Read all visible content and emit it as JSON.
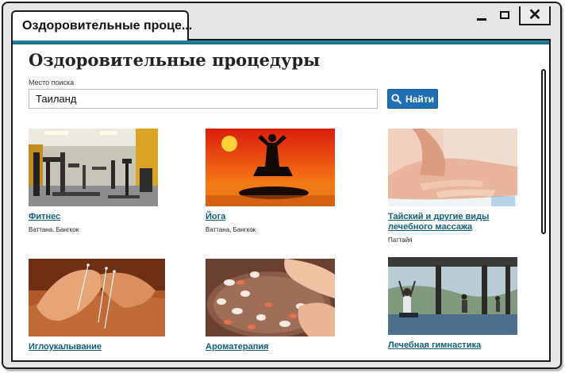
{
  "window": {
    "tab_title": "Оздоровительные проце...",
    "controls": {
      "minimize_icon": "minimize-icon",
      "maximize_icon": "maximize-icon",
      "close_label": "✕"
    }
  },
  "page": {
    "title": "Оздоровительные процедуры",
    "accent_color": "#14677f",
    "link_color": "#0f5f7a"
  },
  "search": {
    "label": "Место поиска",
    "value": "Таиланд",
    "button_label": "Найти",
    "button_icon": "search-icon",
    "button_color": "#1f6fb3"
  },
  "results": [
    {
      "title": "Фитнес",
      "location": "Ваттана, Бангкок",
      "image": "gym-equipment-photo"
    },
    {
      "title": "Йога",
      "location": "Ваттана, Бангкок",
      "image": "yoga-sunset-silhouette-photo"
    },
    {
      "title": "Тайский и другие виды лечебного массажа",
      "location": "Паттайя",
      "image": "back-massage-photo"
    },
    {
      "title": "Иглоукалывание",
      "location": "",
      "image": "acupuncture-photo"
    },
    {
      "title": "Ароматерапия",
      "location": "",
      "image": "flower-petals-bowl-photo"
    },
    {
      "title": "Лечебная гимнастика",
      "location": "",
      "image": "group-yoga-terrace-photo"
    }
  ]
}
